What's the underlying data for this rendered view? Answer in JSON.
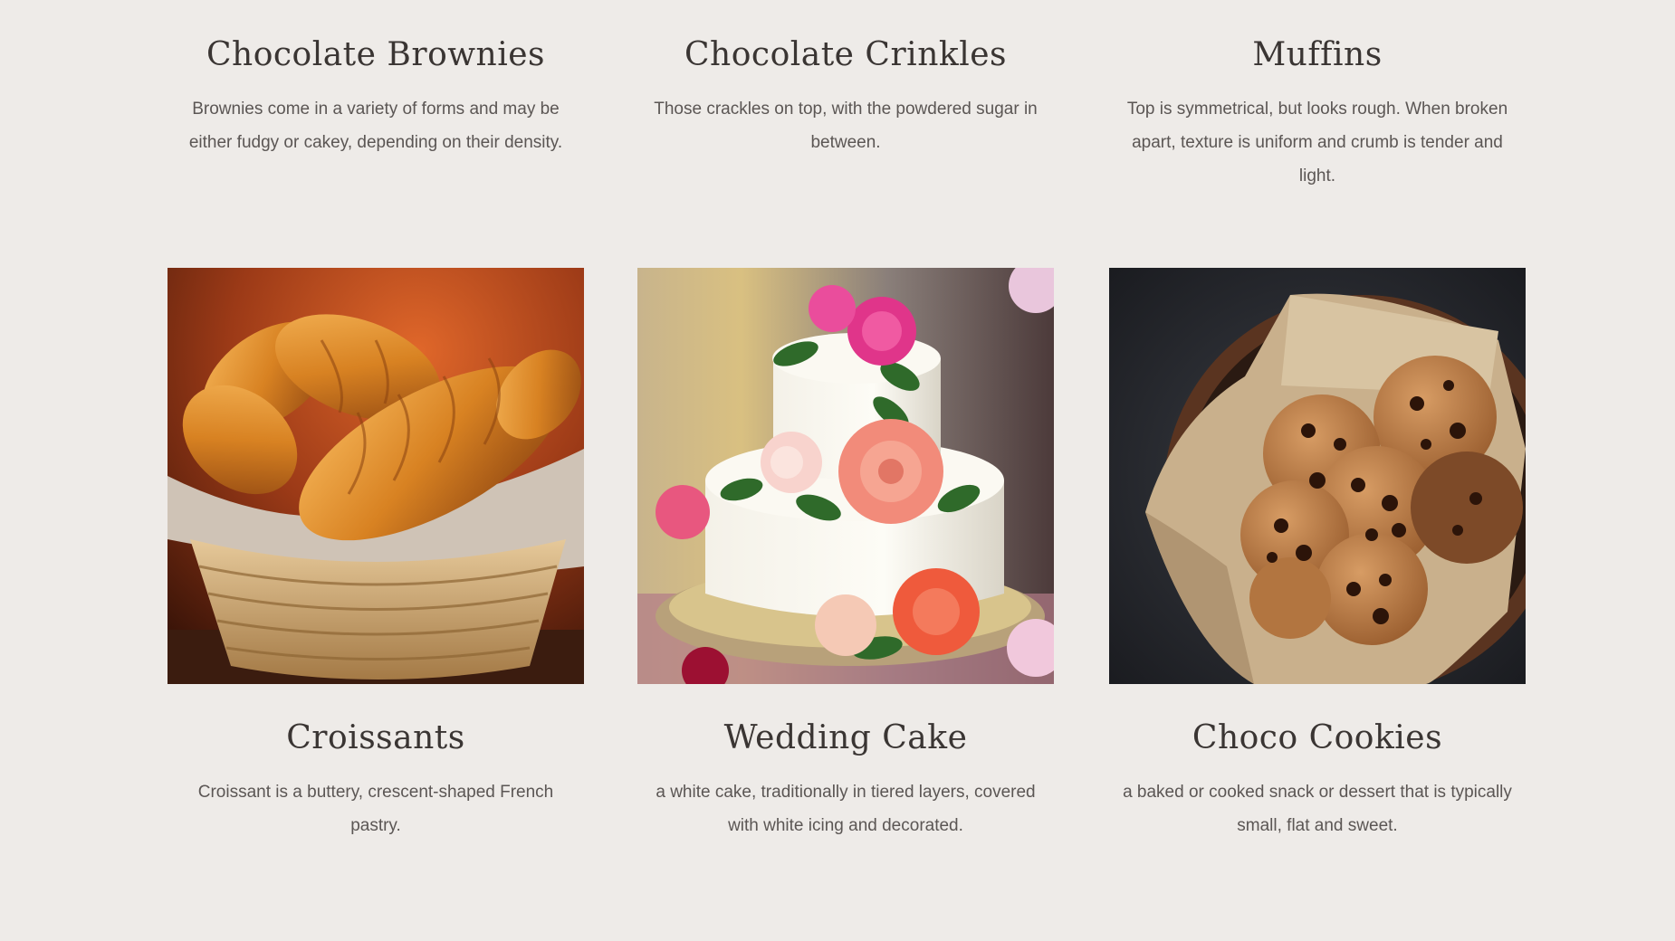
{
  "top_row": [
    {
      "title": "Chocolate Brownies",
      "description": "Brownies come in a variety of forms and may be either fudgy or cakey, depending on their density."
    },
    {
      "title": "Chocolate Crinkles",
      "description": "Those crackles on top, with the powdered sugar in between."
    },
    {
      "title": "Muffins",
      "description": "Top is symmetrical, but looks rough. When broken apart, texture is uniform and crumb is tender and light."
    }
  ],
  "bottom_row": [
    {
      "title": "Croissants",
      "description": "Croissant is a buttery, crescent-shaped French pastry."
    },
    {
      "title": "Wedding Cake",
      "description": "a white cake, traditionally in tiered layers, covered with white icing and decorated."
    },
    {
      "title": "Choco Cookies",
      "description": "a baked or cooked snack or dessert that is typically small, flat and sweet."
    }
  ],
  "colors": {
    "background": "#eeebe8",
    "title": "#3a3533",
    "text": "#5b5654"
  }
}
